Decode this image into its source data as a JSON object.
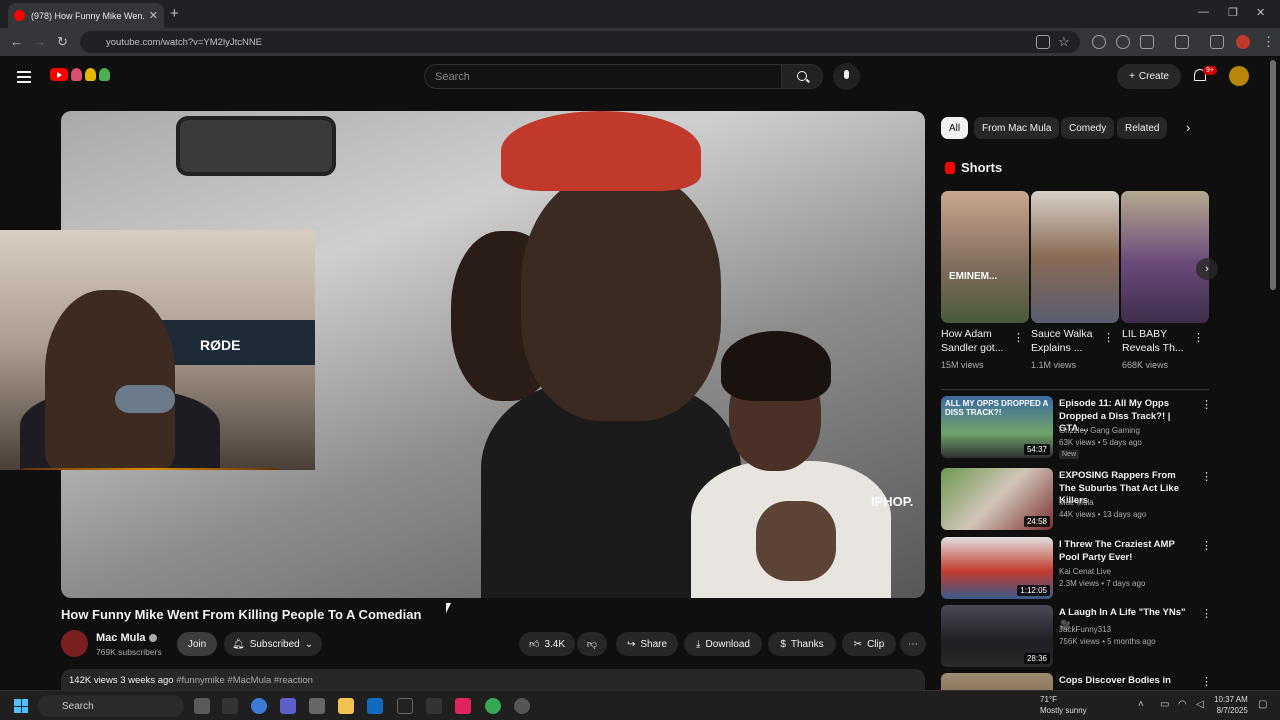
{
  "browser": {
    "tab_title": "(978) How Funny Mike Wen...",
    "url": "youtube.com/watch?v=YM2lyJtcNNE"
  },
  "header": {
    "search_placeholder": "Search",
    "create_label": "Create",
    "notifications_badge": "9+"
  },
  "video": {
    "title": "How Funny Mike Went From Killing People To A Comedian",
    "watermark": "IPHOP.",
    "channel_name": "Mac Mula",
    "subscribers": "769K subscribers",
    "join_label": "Join",
    "subscribed_label": "Subscribed",
    "likes": "3.4K",
    "share_label": "Share",
    "download_label": "Download",
    "thanks_label": "Thanks",
    "clip_label": "Clip",
    "stats": "142K views  3 weeks ago",
    "hashtags": "#funnymike #MacMula #reaction",
    "overlay_mic_brand": "RØDE"
  },
  "sidebar": {
    "chips": [
      "All",
      "From Mac Mula",
      "Comedy",
      "Related"
    ],
    "shorts_heading": "Shorts",
    "shorts": [
      {
        "title": "How Adam Sandler got...",
        "views": "15M views",
        "thumb_text": "EMINEM..."
      },
      {
        "title": "Sauce Walka Explains ...",
        "views": "1.1M views",
        "thumb_text": ""
      },
      {
        "title": "LIL BABY Reveals Th...",
        "views": "668K views",
        "thumb_text": ""
      }
    ],
    "recommendations": [
      {
        "title": "Episode 11: All My Opps Dropped a Diss Track?! | GTA ...",
        "channel": "Grizzley Gang Gaming",
        "meta": "63K views • 5 days ago",
        "duration": "54:37",
        "badge": "New",
        "overlay": "ALL MY OPPS DROPPED A DISS TRACK?!"
      },
      {
        "title": "EXPOSING Rappers From The Suburbs That Act Like Killers",
        "channel": "Mac Mula",
        "meta": "44K views • 13 days ago",
        "duration": "24:58",
        "badge": "",
        "overlay": ""
      },
      {
        "title": "I Threw The Craziest AMP Pool Party Ever!",
        "channel": "Kai Cenat Live",
        "meta": "2.3M views • 7 days ago",
        "duration": "1:12:05",
        "badge": "",
        "overlay": ""
      },
      {
        "title": "A Laugh In A Life \"The YNs\" 🎥",
        "channel": "JackFunny313",
        "meta": "756K views • 5 months ago",
        "duration": "28:36",
        "badge": "",
        "overlay": ""
      },
      {
        "title": "Cops Discover Bodies in",
        "channel": "",
        "meta": "",
        "duration": "",
        "badge": "",
        "overlay": ""
      }
    ]
  },
  "taskbar": {
    "search_label": "Search",
    "weather_temp": "71°F",
    "weather_desc": "Mostly sunny",
    "time": "10:37 AM",
    "date": "8/7/2025"
  },
  "colors": {
    "accent": "#ff0000",
    "background": "#0f0f0f",
    "chip": "#272727"
  }
}
